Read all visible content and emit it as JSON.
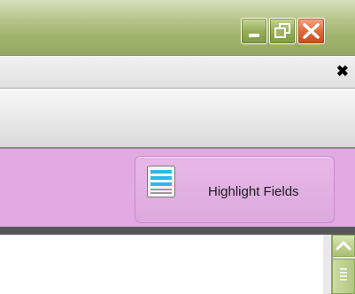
{
  "window": {
    "buttons": [
      {
        "name": "minimize",
        "icon": "minimize-icon"
      },
      {
        "name": "maximize",
        "icon": "restore-icon"
      },
      {
        "name": "close",
        "icon": "close-icon"
      }
    ],
    "accent_color": "#a3b46f",
    "close_color": "#e36a3e"
  },
  "tab": {
    "close_glyph": "✖",
    "close_icon": "close-tab-icon"
  },
  "ribbon": {
    "color": "#e2a9e2",
    "highlight_button": {
      "label": "Highlight Fields",
      "icon": "highlight-fields-icon"
    }
  },
  "scrollbar": {
    "up_icon": "chevron-up-icon",
    "thumb_icon": "grip-icon"
  }
}
